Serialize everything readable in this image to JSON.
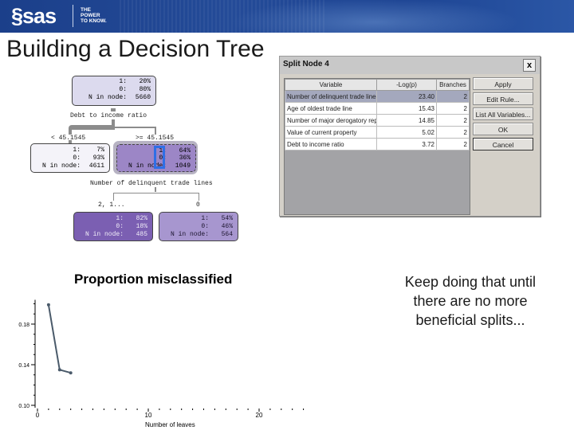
{
  "banner": {
    "logo_text": "sas",
    "tagline": [
      "THE",
      "POWER",
      "TO KNOW."
    ]
  },
  "slide": {
    "title": "Building a Decision Tree",
    "note": "Keep doing that until there are no more beneficial splits..."
  },
  "tree": {
    "root": {
      "rows": [
        [
          "1:",
          "20%"
        ],
        [
          "0:",
          "80%"
        ],
        [
          "N in node:",
          "5660"
        ]
      ],
      "split_variable": "Debt to income ratio"
    },
    "left_branch_label": "< 45.1545",
    "right_branch_label": ">= 45.1545",
    "left": {
      "rows": [
        [
          "1:",
          "7%"
        ],
        [
          "0:",
          "93%"
        ],
        [
          "N in node:",
          "4611"
        ]
      ]
    },
    "right": {
      "rows": [
        [
          "1:",
          "64%"
        ],
        [
          "0:",
          "36%"
        ],
        [
          "N in node:",
          "1049"
        ]
      ],
      "split_variable": "Number of delinquent trade lines"
    },
    "right_left_branch_label": "2, 1...",
    "right_right_branch_label": "0",
    "right_left": {
      "rows": [
        [
          "1:",
          "82%"
        ],
        [
          "0:",
          "18%"
        ],
        [
          "N in node:",
          "485"
        ]
      ]
    },
    "right_right": {
      "rows": [
        [
          "1:",
          "54%"
        ],
        [
          "0:",
          "46%"
        ],
        [
          "N in node:",
          "564"
        ]
      ]
    },
    "colors": {
      "root": "#dcdaee",
      "left": "#f4f3f9",
      "right": "#9c86c6",
      "right_left": "#7b5fb2",
      "right_right": "#a796cf",
      "highlight": "#2f6fe6"
    }
  },
  "dialog": {
    "title": "Split Node 4",
    "close_label": "x",
    "columns": [
      "Variable",
      "-Log(p)",
      "Branches"
    ],
    "rows": [
      {
        "variable": "Number of delinquent trade lines",
        "logp": "23.40",
        "branches": "2",
        "selected": true
      },
      {
        "variable": "Age of oldest trade line",
        "logp": "15.43",
        "branches": "2",
        "selected": false
      },
      {
        "variable": "Number of major derogatory reports",
        "logp": "14.85",
        "branches": "2",
        "selected": false
      },
      {
        "variable": "Value of current property",
        "logp": "5.02",
        "branches": "2",
        "selected": false
      },
      {
        "variable": "Debt to income ratio",
        "logp": "3.72",
        "branches": "2",
        "selected": false
      }
    ],
    "buttons": {
      "apply": "Apply",
      "edit_rule": "Edit Rule...",
      "list_all": "List All Variables...",
      "ok": "OK",
      "cancel": "Cancel"
    }
  },
  "chart_data": {
    "type": "line",
    "title": "Proportion misclassified",
    "xlabel": "Number of leaves",
    "ylabel": "",
    "x": [
      1,
      2,
      3
    ],
    "series": [
      {
        "name": "Proportion misclassified",
        "values": [
          0.199,
          0.135,
          0.132
        ],
        "color": "#4a5a6a"
      }
    ],
    "xlim": [
      0,
      30
    ],
    "ylim": [
      0.1,
      0.2
    ],
    "xticks": [
      0,
      10,
      20
    ],
    "yticks": [
      0.1,
      0.14,
      0.18
    ],
    "ytick_labels": [
      "0.10",
      "0.14",
      "0.18"
    ],
    "xtick_labels": [
      "0",
      "10",
      "20"
    ],
    "grid": false
  }
}
